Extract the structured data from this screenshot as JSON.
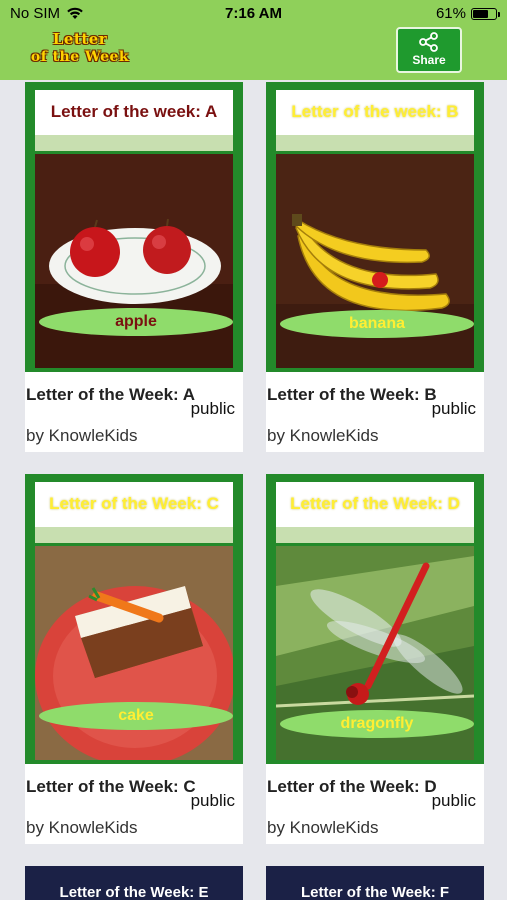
{
  "status": {
    "carrier": "No SIM",
    "time": "7:16 AM",
    "battery": "61%",
    "battery_level": 0.61
  },
  "header": {
    "logo_line1": "Letter",
    "logo_line2": "of the Week",
    "share_label": "Share"
  },
  "colors": {
    "header_bg": "#8fd05a",
    "card_frame": "#238a2a",
    "pill": "#8fdc6b",
    "share_bg": "#1f9a2e"
  },
  "cards": [
    {
      "banner": "Letter of the week: A",
      "word": "apple",
      "title": "Letter of the Week: A",
      "visibility": "public",
      "author": "by KnowleKids"
    },
    {
      "banner": "Letter of the week: B",
      "word": "banana",
      "title": "Letter of the Week: B",
      "visibility": "public",
      "author": "by KnowleKids"
    },
    {
      "banner": "Letter of the Week: C",
      "word": "cake",
      "title": "Letter of the Week: C",
      "visibility": "public",
      "author": "by KnowleKids"
    },
    {
      "banner": "Letter of the Week: D",
      "word": "dragonfly",
      "title": "Letter of the Week: D",
      "visibility": "public",
      "author": "by KnowleKids"
    },
    {
      "banner": "Letter of the Week: E"
    },
    {
      "banner": "Letter of the Week: F"
    }
  ]
}
